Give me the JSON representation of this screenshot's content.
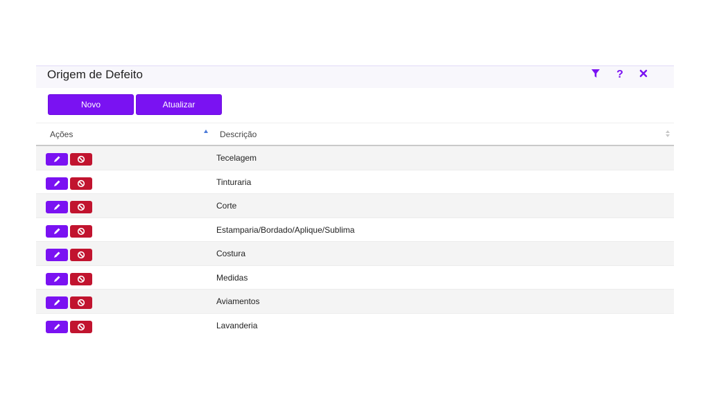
{
  "window": {
    "title": "Origem de Defeito",
    "icons": [
      "filter-icon",
      "help-icon",
      "close-icon"
    ],
    "help_glyph": "?"
  },
  "toolbar": {
    "new_label": "Novo",
    "refresh_label": "Atualizar"
  },
  "table": {
    "columns": {
      "actions": "Ações",
      "description": "Descrição"
    },
    "sort": {
      "actions": "ascending",
      "description": "none"
    },
    "rows": [
      {
        "description": "Tecelagem"
      },
      {
        "description": "Tinturaria"
      },
      {
        "description": "Corte"
      },
      {
        "description": "Estamparia/Bordado/Aplique/Sublima"
      },
      {
        "description": "Costura"
      },
      {
        "description": "Medidas"
      },
      {
        "description": "Aviamentos"
      },
      {
        "description": "Lavanderia"
      }
    ],
    "row_action_icons": [
      "pencil-icon",
      "block-icon"
    ]
  },
  "colors": {
    "accent": "#7a12f2",
    "danger": "#c1142f",
    "row_stripe": "#f4f4f4"
  }
}
